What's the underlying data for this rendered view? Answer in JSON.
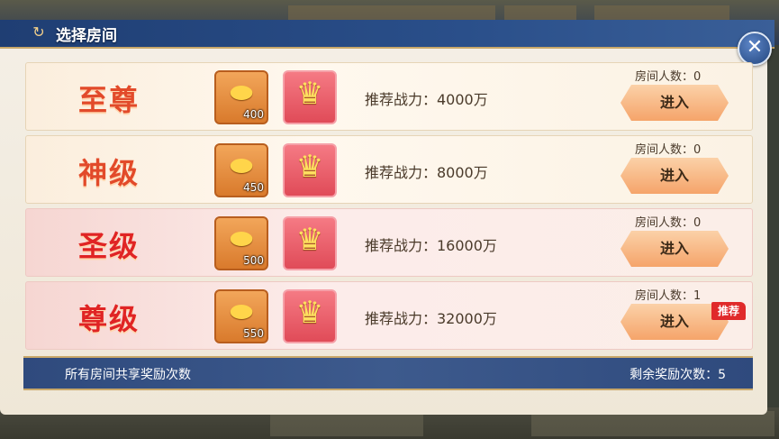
{
  "dialog": {
    "title": "选择房间",
    "title_icon": "return-arrow-icon",
    "close_icon": "close-icon"
  },
  "rooms": [
    {
      "name": "至尊",
      "ingot_count": "400",
      "power_label": "推荐战力：4000万",
      "occupancy_label": "房间人数：0",
      "enter_label": "进入",
      "theme": "gold"
    },
    {
      "name": "神级",
      "ingot_count": "450",
      "power_label": "推荐战力：8000万",
      "occupancy_label": "房间人数：0",
      "enter_label": "进入",
      "theme": "gold"
    },
    {
      "name": "圣级",
      "ingot_count": "500",
      "power_label": "推荐战力：16000万",
      "occupancy_label": "房间人数：0",
      "enter_label": "进入",
      "theme": "pink"
    },
    {
      "name": "尊级",
      "ingot_count": "550",
      "power_label": "推荐战力：32000万",
      "occupancy_label": "房间人数：1",
      "enter_label": "进入",
      "theme": "pink",
      "badge": "推荐"
    }
  ],
  "footer": {
    "shared_label": "所有房间共享奖励次数",
    "remaining_label": "剩余奖励次数：5"
  },
  "colors": {
    "header": "#1f3e73",
    "name_red": "#e24a2a",
    "button": "#f5a46a",
    "badge": "#e02a2a"
  }
}
